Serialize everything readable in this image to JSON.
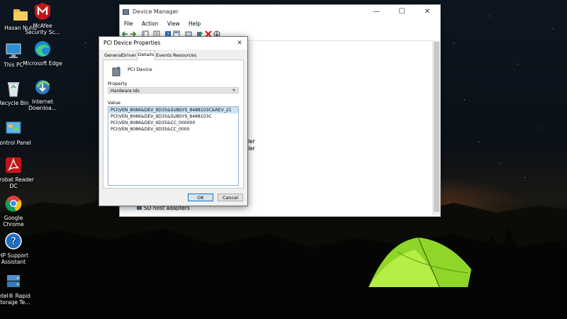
{
  "desktop": {
    "icons": [
      {
        "label": "Hasan Nuhu",
        "icon": "folder-icon"
      },
      {
        "label": "McAfee Security Sc...",
        "icon": "mcafee-icon"
      },
      {
        "label": "This PC",
        "icon": "computer-icon"
      },
      {
        "label": "Microsoft Edge",
        "icon": "edge-icon"
      },
      {
        "label": "Recycle Bin",
        "icon": "recycle-bin-icon"
      },
      {
        "label": "Internet Downloa...",
        "icon": "idm-icon"
      },
      {
        "label": "Control Panel",
        "icon": "control-panel-icon"
      },
      {
        "label": "Acrobat Reader DC",
        "icon": "acrobat-icon"
      },
      {
        "label": "Google Chrome",
        "icon": "chrome-icon"
      },
      {
        "label": "HP Support Assistant",
        "icon": "help-icon"
      },
      {
        "label": "Intel® Rapid Storage Te...",
        "icon": "intel-storage-icon"
      }
    ]
  },
  "device_manager": {
    "title": "Device Manager",
    "menu": [
      "File",
      "Action",
      "View",
      "Help"
    ],
    "partial_text": [
      "ller",
      "ller",
      "SD host adapters"
    ]
  },
  "dialog": {
    "title": "PCI Device Properties",
    "tabs": [
      "General",
      "Driver",
      "Details",
      "Events",
      "Resources"
    ],
    "active_tab": "Details",
    "device_name": "PCI Device",
    "property_label": "Property",
    "property_value": "Hardware Ids",
    "value_label": "Value",
    "values": [
      "PCI\\VEN_8086&DEV_9D35&SUBSYS_8488103C&REV_21",
      "PCI\\VEN_8086&DEV_9D35&SUBSYS_8488103C",
      "PCI\\VEN_8086&DEV_9D35&CC_000000",
      "PCI\\VEN_8086&DEV_9D35&CC_0000"
    ],
    "ok_label": "OK",
    "cancel_label": "Cancel"
  },
  "colors": {
    "selection": "#cce4f7",
    "accent": "#0078d7",
    "tent": "#8fd629"
  }
}
